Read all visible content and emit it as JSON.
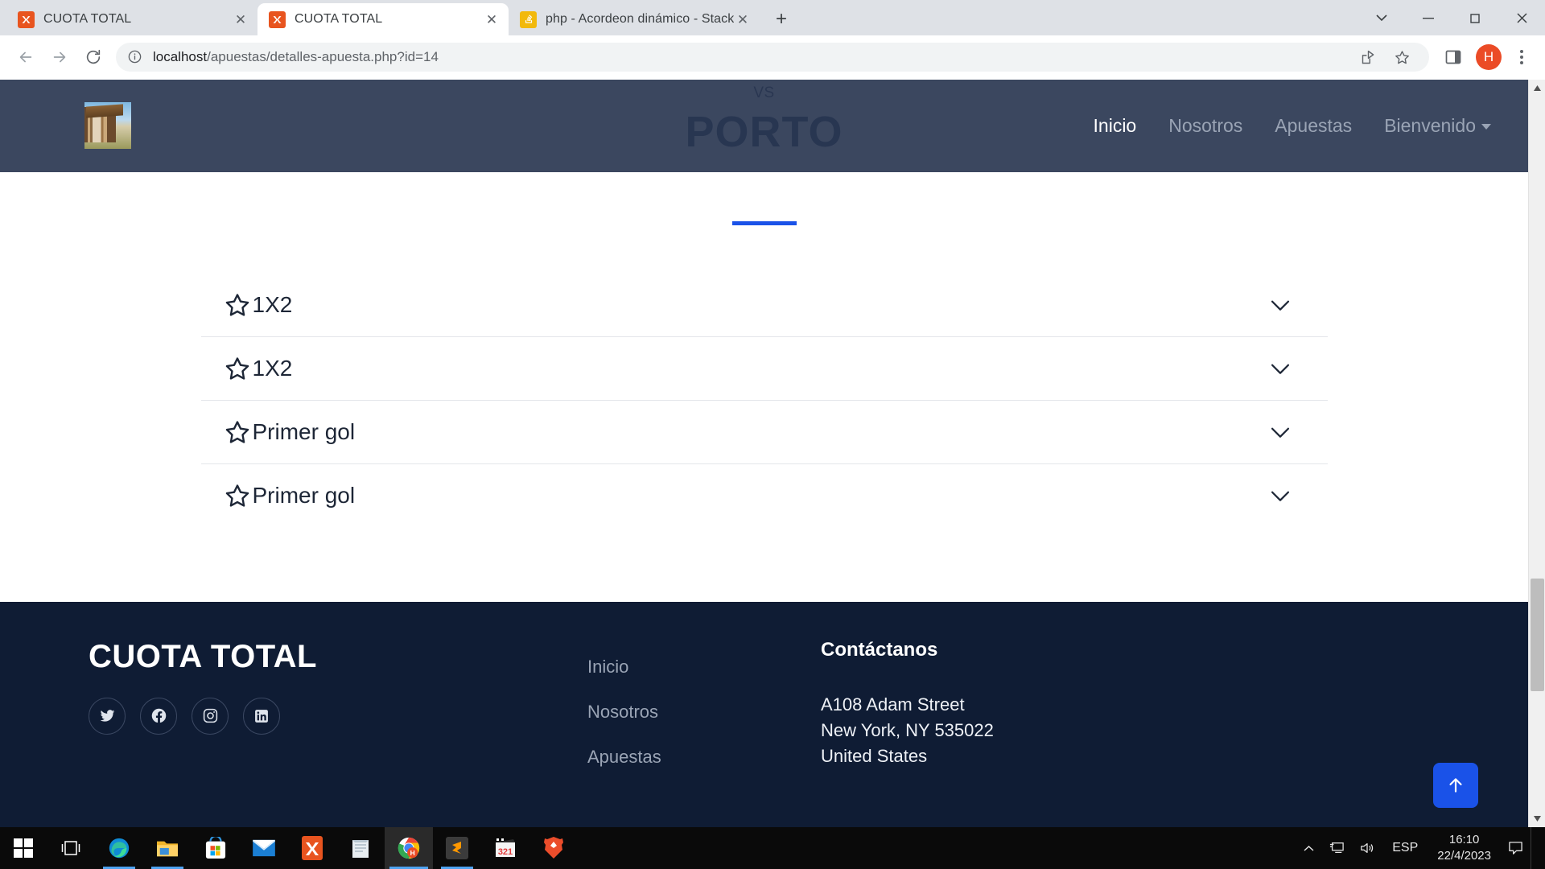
{
  "browser": {
    "tabs": [
      {
        "title": "CUOTA TOTAL",
        "favicon": "xampp-icon",
        "active": false
      },
      {
        "title": "CUOTA TOTAL",
        "favicon": "xampp-icon",
        "active": true
      },
      {
        "title": "php - Acordeon dinámico - Stack",
        "favicon": "stackoverflow-icon",
        "active": false
      }
    ],
    "new_tab_label": "+",
    "close_label": "✕",
    "window_controls": {
      "minimize": "minimize-icon",
      "maximize": "maximize-icon",
      "close": "close-icon",
      "expand": "chevron-down-icon"
    },
    "nav": {
      "back": "back-arrow-icon",
      "forward": "forward-arrow-icon",
      "reload": "reload-icon"
    },
    "omnibox": {
      "info_icon": "site-info-icon",
      "url_host": "localhost",
      "url_path": "/apuestas/detalles-apuesta.php?id=14",
      "share_icon": "share-icon",
      "bookmark_icon": "star-icon",
      "sidepanel_icon": "side-panel-icon",
      "avatar_letter": "H",
      "menu_icon": "three-dots-menu-icon"
    }
  },
  "site": {
    "hero": {
      "vs": "VS",
      "team": "PORTO"
    },
    "header": {
      "logo_alt": "beach-house-logo",
      "nav": [
        {
          "label": "Inicio",
          "active": true
        },
        {
          "label": "Nosotros",
          "active": false
        },
        {
          "label": "Apuestas",
          "active": false
        },
        {
          "label": "Bienvenido",
          "active": false,
          "has_dropdown": true
        }
      ]
    },
    "accordion": {
      "items": [
        {
          "label": "1X2",
          "icon": "star-outline-icon",
          "chevron": "chevron-down-icon"
        },
        {
          "label": "1X2",
          "icon": "star-outline-icon",
          "chevron": "chevron-down-icon"
        },
        {
          "label": "Primer gol",
          "icon": "star-outline-icon",
          "chevron": "chevron-down-icon"
        },
        {
          "label": "Primer gol",
          "icon": "star-outline-icon",
          "chevron": "chevron-down-icon"
        }
      ]
    },
    "footer": {
      "brand": "CUOTA TOTAL",
      "socials": [
        {
          "name": "twitter-icon"
        },
        {
          "name": "facebook-icon"
        },
        {
          "name": "instagram-icon"
        },
        {
          "name": "linkedin-icon"
        }
      ],
      "links": [
        "Inicio",
        "Nosotros",
        "Apuestas"
      ],
      "contact_heading": "Contáctanos",
      "address_line1": "A108 Adam Street",
      "address_line2": "New York, NY 535022",
      "address_line3": "United States",
      "to_top_icon": "arrow-up-icon"
    },
    "accent_color": "#1a52e8"
  },
  "taskbar": {
    "start": "windows-start-icon",
    "apps": [
      {
        "name": "task-view-icon"
      },
      {
        "name": "edge-icon",
        "running": true
      },
      {
        "name": "file-explorer-icon",
        "running": true
      },
      {
        "name": "microsoft-store-icon"
      },
      {
        "name": "mail-icon"
      },
      {
        "name": "xampp-icon"
      },
      {
        "name": "notepad-icon"
      },
      {
        "name": "chrome-icon",
        "active": true
      },
      {
        "name": "sublime-text-icon",
        "running": true
      },
      {
        "name": "video-editor-icon"
      },
      {
        "name": "brave-icon"
      }
    ],
    "tray": {
      "overflow": "chevron-up-icon",
      "network": "network-icon",
      "volume": "volume-icon",
      "language": "ESP",
      "time": "16:10",
      "date": "22/4/2023",
      "notifications": "notification-icon"
    }
  }
}
